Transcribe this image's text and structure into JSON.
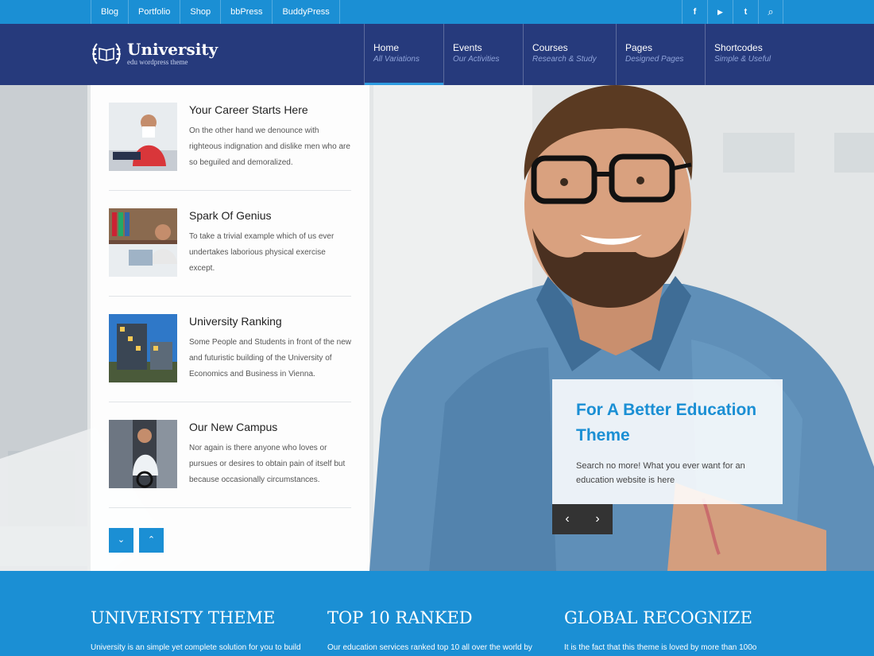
{
  "topbar": {
    "links": [
      "Blog",
      "Portfolio",
      "Shop",
      "bbPress",
      "BuddyPress"
    ],
    "social": [
      {
        "icon": "facebook-icon",
        "glyph": "f"
      },
      {
        "icon": "youtube-icon",
        "glyph": "▶"
      },
      {
        "icon": "twitter-icon",
        "glyph": "t"
      },
      {
        "icon": "search-icon",
        "glyph": "⌕"
      }
    ]
  },
  "header": {
    "logo_title": "University",
    "logo_tagline": "edu wordpress theme",
    "nav": [
      {
        "title": "Home",
        "subtitle": "All Variations"
      },
      {
        "title": "Events",
        "subtitle": "Our Activities"
      },
      {
        "title": "Courses",
        "subtitle": "Research & Study"
      },
      {
        "title": "Pages",
        "subtitle": "Designed Pages"
      },
      {
        "title": "Shortcodes",
        "subtitle": "Simple & Useful"
      }
    ]
  },
  "news": [
    {
      "title": "Your Career Starts Here",
      "text": "On the other hand we denounce with righteous indignation and dislike men who are so beguiled and demoralized."
    },
    {
      "title": "Spark Of Genius",
      "text": "To take a trivial example which of us ever undertakes laborious physical exercise except."
    },
    {
      "title": "University Ranking",
      "text": "Some People and Students in front of the new and futuristic building of the University of Economics and Business in Vienna."
    },
    {
      "title": "Our New Campus",
      "text": "Nor again is there anyone who loves or pursues or desires to obtain pain of itself but because occasionally circumstances."
    }
  ],
  "panel_arrows": {
    "down": "⌄",
    "up": "⌃"
  },
  "slide": {
    "heading": "For A Better Education Theme",
    "text": "Search no more! What you ever want for an education website is here",
    "prev": "‹",
    "next": "›"
  },
  "features": [
    {
      "title": "UNIVERISTY THEME",
      "text": "University is an simple yet complete solution for you to build"
    },
    {
      "title": "TOP 10 RANKED",
      "text": "Our education services ranked top 10 all over the world by"
    },
    {
      "title": "GLOBAL RECOGNIZE",
      "text": "It is the fact that this theme is loved by more than 100o"
    }
  ],
  "colors": {
    "topbar": "#1b8fd4",
    "header": "#263a7c",
    "accent": "#1b8fd4"
  }
}
